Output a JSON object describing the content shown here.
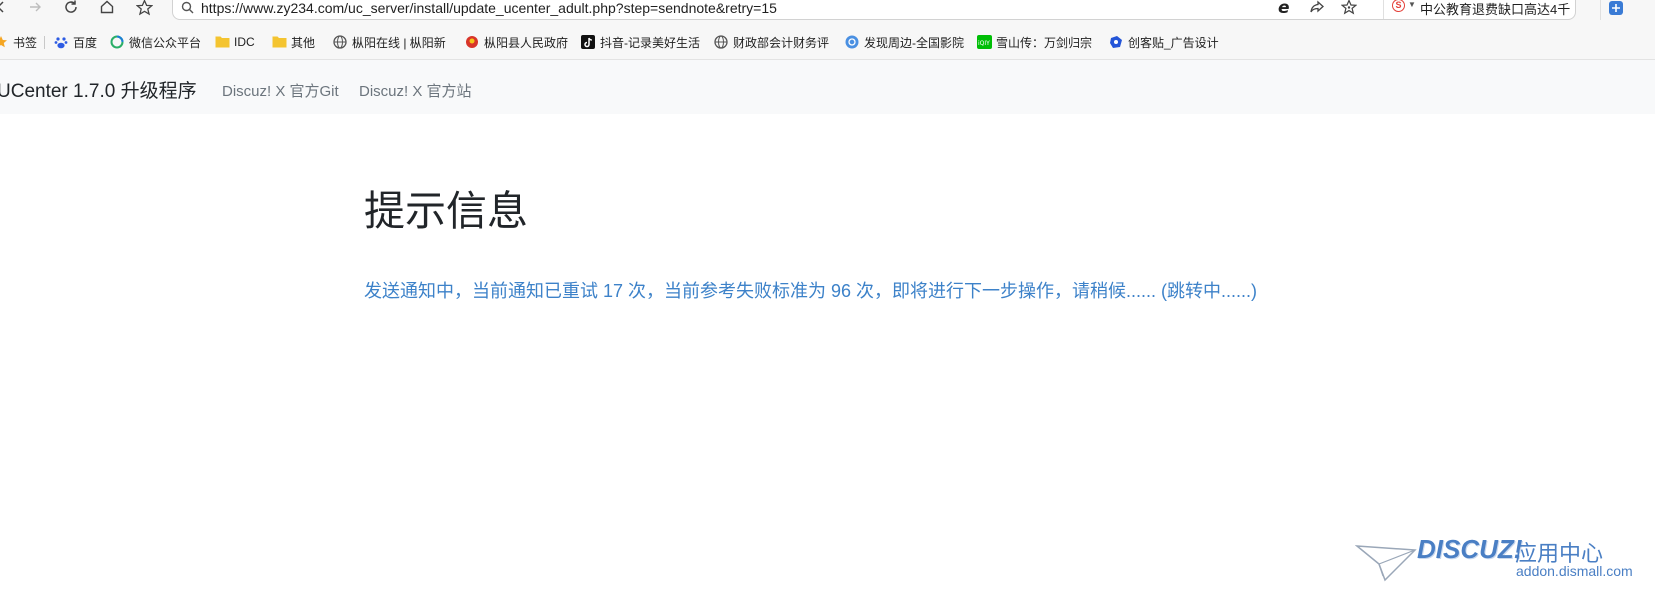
{
  "browser": {
    "url": "https://www.zy234.com/uc_server/install/update_ucenter_adult.php?step=sendnote&retry=15",
    "hot_search": "中公教育退费缺口高达4千",
    "icons": [
      "back-icon",
      "forward-icon",
      "reload-icon",
      "home-icon",
      "favorite-icon",
      "search-icon",
      "ie-mode-icon",
      "share-icon",
      "bookmark-star-icon",
      "sogou-icon",
      "extension-icon"
    ]
  },
  "bookmarks": {
    "items": [
      {
        "label": "书签",
        "icon": "star-icon"
      },
      {
        "label": "百度",
        "icon": "baidu-icon"
      },
      {
        "label": "微信公众平台",
        "icon": "wechat-icon"
      },
      {
        "label": "IDC",
        "icon": "folder-icon"
      },
      {
        "label": "其他",
        "icon": "folder-icon"
      },
      {
        "label": "枞阳在线 | 枞阳新",
        "icon": "globe-icon"
      },
      {
        "label": "枞阳县人民政府",
        "icon": "emblem-icon"
      },
      {
        "label": "抖音-记录美好生活",
        "icon": "douyin-icon"
      },
      {
        "label": "财政部会计财务评",
        "icon": "globe-icon"
      },
      {
        "label": "发现周边-全国影院",
        "icon": "discover-icon"
      },
      {
        "label": "雪山传：万剑归宗",
        "icon": "iqiyi-icon"
      },
      {
        "label": "创客贴_广告设计",
        "icon": "chuangkit-icon"
      }
    ]
  },
  "navbar": {
    "brand": "UCenter 1.7.0 升级程序",
    "links": [
      "Discuz! X 官方Git",
      "Discuz! X 官方站"
    ]
  },
  "main": {
    "heading": "提示信息",
    "message": "发送通知中，当前通知已重试 17 次，当前参考失败标准为 96 次，即将进行下一步操作，请稍候...... (跳转中......)"
  },
  "watermark": {
    "brand": "DISCUZ!",
    "subtitle": "应用中心",
    "domain": "addon.dismall.com"
  },
  "colors": {
    "link_blue": "#3d82c9",
    "navbar_bg": "#f8f9fa",
    "watermark_blue": "#4a7fc4"
  }
}
